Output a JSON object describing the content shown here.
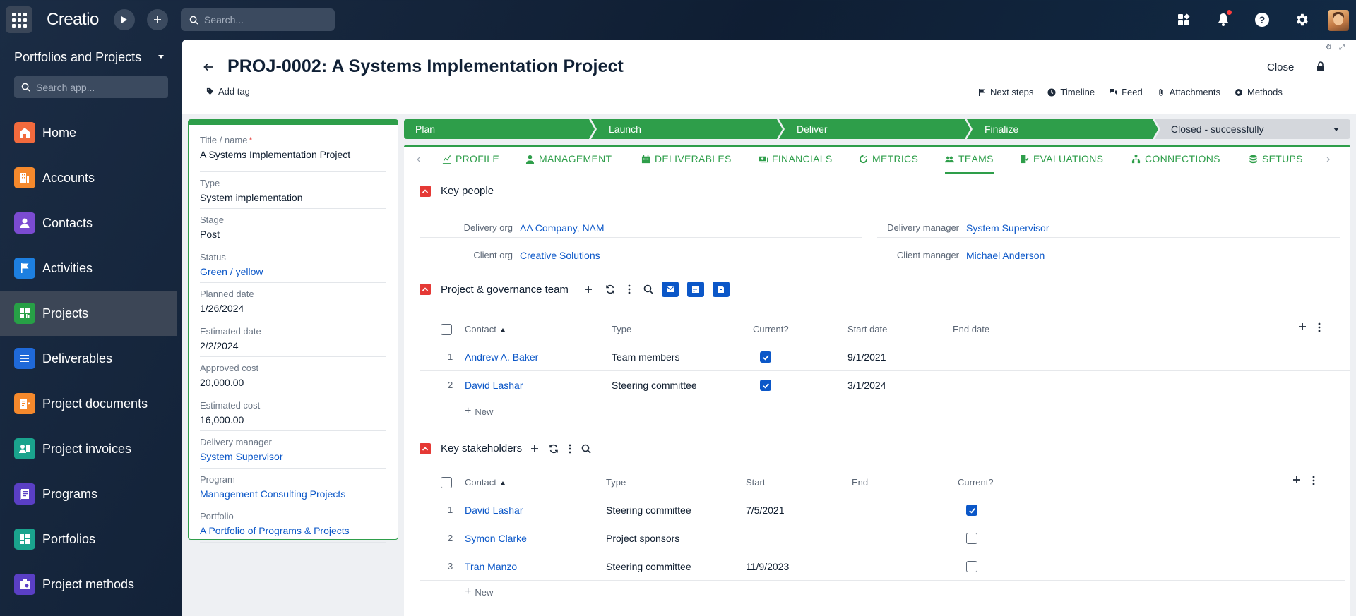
{
  "topbar": {
    "logo": "Creatio",
    "search_placeholder": "Search..."
  },
  "sidebar": {
    "title": "Portfolios and Projects",
    "search_placeholder": "Search app...",
    "items": [
      {
        "label": "Home",
        "color": "#f26a3d",
        "icon": "home-icon"
      },
      {
        "label": "Accounts",
        "color": "#f5892c",
        "icon": "building-icon"
      },
      {
        "label": "Contacts",
        "color": "#7b4bd1",
        "icon": "person-icon"
      },
      {
        "label": "Activities",
        "color": "#1d7fe0",
        "icon": "flag-icon"
      },
      {
        "label": "Projects",
        "color": "#27a046",
        "icon": "project-icon"
      },
      {
        "label": "Deliverables",
        "color": "#1f69d8",
        "icon": "list-icon"
      },
      {
        "label": "Project documents",
        "color": "#f5892c",
        "icon": "document-icon"
      },
      {
        "label": "Project invoices",
        "color": "#1aa38d",
        "icon": "invoice-icon"
      },
      {
        "label": "Programs",
        "color": "#5a3fc4",
        "icon": "programs-icon"
      },
      {
        "label": "Portfolios",
        "color": "#1aa38d",
        "icon": "portfolio-icon"
      },
      {
        "label": "Project methods",
        "color": "#5a3fc4",
        "icon": "methods-icon"
      }
    ]
  },
  "header": {
    "title": "PROJ-0002: A Systems Implementation Project",
    "add_tag": "Add tag",
    "close": "Close",
    "actions": [
      "Next steps",
      "Timeline",
      "Feed",
      "Attachments",
      "Methods"
    ]
  },
  "card": {
    "fields": [
      {
        "label": "Title / name",
        "value": "A Systems Implementation Project",
        "required": "*",
        "link": false
      },
      {
        "label": "Type",
        "value": "System implementation",
        "link": false
      },
      {
        "label": "Stage",
        "value": "Post",
        "link": false
      },
      {
        "label": "Status",
        "value": "Green / yellow",
        "link": true
      },
      {
        "label": "Planned date",
        "value": "1/26/2024",
        "link": false
      },
      {
        "label": "Estimated date",
        "value": "2/2/2024",
        "link": false
      },
      {
        "label": "Approved cost",
        "value": "20,000.00",
        "link": false
      },
      {
        "label": "Estimated cost",
        "value": "16,000.00",
        "link": false
      },
      {
        "label": "Delivery manager",
        "value": "System Supervisor",
        "link": true
      },
      {
        "label": "Program",
        "value": "Management Consulting Projects",
        "link": true
      },
      {
        "label": "Portfolio",
        "value": "A Portfolio of Programs & Projects",
        "link": true
      }
    ]
  },
  "stages": [
    "Plan",
    "Launch",
    "Deliver",
    "Finalize",
    "Closed - successfully"
  ],
  "tabs": [
    "PROFILE",
    "MANAGEMENT",
    "DELIVERABLES",
    "FINANCIALS",
    "METRICS",
    "TEAMS",
    "EVALUATIONS",
    "CONNECTIONS",
    "SETUPS"
  ],
  "key_people": {
    "title": "Key people",
    "delivery_org_label": "Delivery org",
    "delivery_org": "AA Company, NAM",
    "client_org_label": "Client org",
    "client_org": "Creative Solutions",
    "delivery_manager_label": "Delivery manager",
    "delivery_manager": "System Supervisor",
    "client_manager_label": "Client manager",
    "client_manager": "Michael Anderson"
  },
  "governance": {
    "title": "Project & governance team",
    "columns": [
      "Contact",
      "Type",
      "Current?",
      "Start date",
      "End date"
    ],
    "rows": [
      {
        "num": "1",
        "contact": "Andrew A. Baker",
        "type": "Team members",
        "current": true,
        "start": "9/1/2021",
        "end": ""
      },
      {
        "num": "2",
        "contact": "David Lashar",
        "type": "Steering committee",
        "current": true,
        "start": "3/1/2024",
        "end": ""
      }
    ],
    "new_label": "New"
  },
  "stakeholders": {
    "title": "Key stakeholders",
    "columns": [
      "Contact",
      "Type",
      "Start",
      "End",
      "Current?"
    ],
    "rows": [
      {
        "num": "1",
        "contact": "David Lashar",
        "type": "Steering committee",
        "start": "7/5/2021",
        "end": "",
        "current": true
      },
      {
        "num": "2",
        "contact": "Symon Clarke",
        "type": "Project sponsors",
        "start": "",
        "end": "",
        "current": false
      },
      {
        "num": "3",
        "contact": "Tran Manzo",
        "type": "Steering committee",
        "start": "11/9/2023",
        "end": "",
        "current": false
      }
    ],
    "new_label": "New"
  }
}
